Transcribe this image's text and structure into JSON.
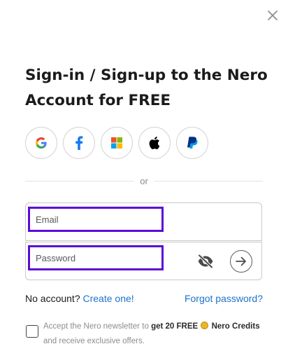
{
  "dialog": {
    "title": "Sign-in / Sign-up to the Nero Account for FREE",
    "close_icon": "close-icon"
  },
  "social": {
    "providers": [
      {
        "name": "Google",
        "icon": "google-icon"
      },
      {
        "name": "Facebook",
        "icon": "facebook-icon",
        "color": "#1877f2"
      },
      {
        "name": "Microsoft",
        "icon": "microsoft-icon"
      },
      {
        "name": "Apple",
        "icon": "apple-icon",
        "color": "#000000"
      },
      {
        "name": "PayPal",
        "icon": "paypal-icon",
        "color": "#003087"
      }
    ]
  },
  "divider": {
    "label": "or"
  },
  "form": {
    "email": {
      "placeholder": "Email",
      "value": ""
    },
    "password": {
      "placeholder": "Password",
      "value": ""
    },
    "show_password_icon": "eye-slash-icon",
    "submit_icon": "arrow-right-icon",
    "highlight_color": "#5b0bd6"
  },
  "links": {
    "no_account": "No account?",
    "create": "Create one!",
    "forgot": "Forgot password?",
    "link_color": "#1f73c8"
  },
  "newsletter": {
    "checked": false,
    "text_before": "Accept the Nero newsletter to ",
    "bold_1": "get 20 FREE",
    "coin_icon": "coin-icon",
    "bold_2": "Nero Credits",
    "text_after": " and receive exclusive offers."
  }
}
